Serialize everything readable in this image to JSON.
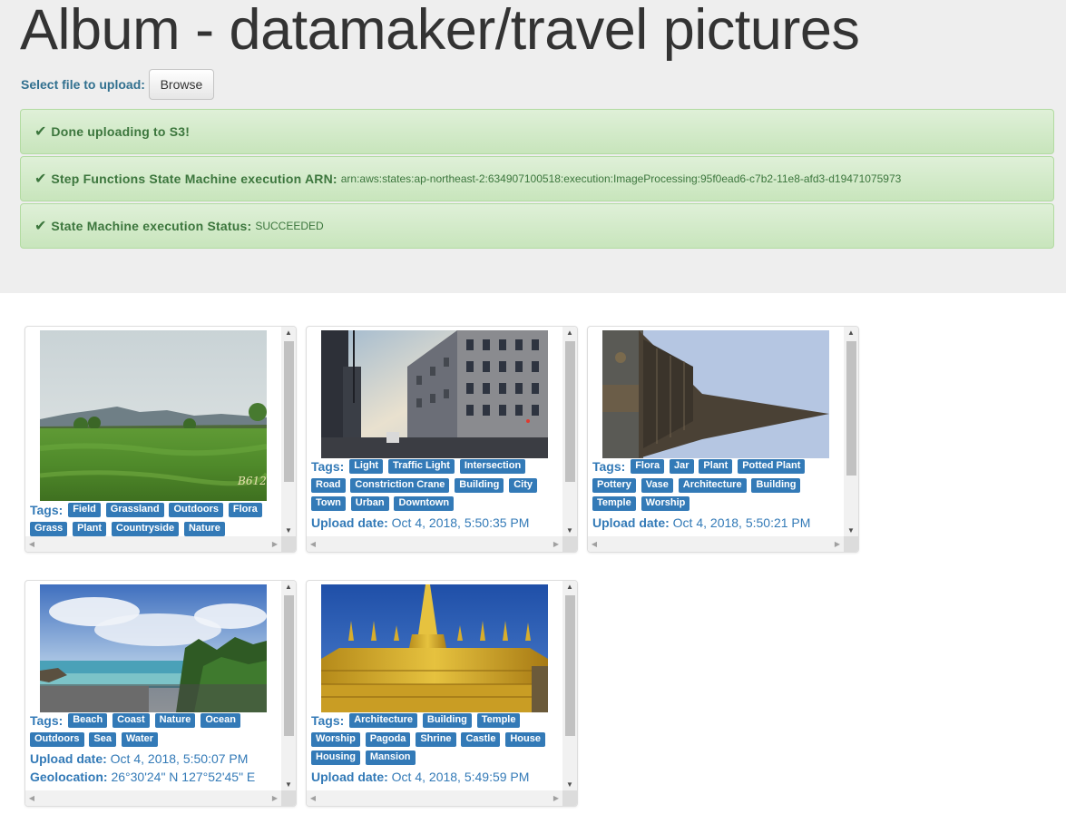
{
  "page": {
    "title": "Album - datamaker/travel pictures",
    "upload_label": "Select file to upload:",
    "browse_label": "Browse"
  },
  "alerts": [
    {
      "label": "Done uploading to S3!",
      "value": ""
    },
    {
      "label": "Step Functions State Machine execution ARN:",
      "value": "arn:aws:states:ap-northeast-2:634907100518:execution:ImageProcessing:95f0ead6-c7b2-11e8-afd3-d19471075973"
    },
    {
      "label": "State Machine execution Status:",
      "value": "SUCCEEDED"
    }
  ],
  "labels": {
    "tags": "Tags:",
    "upload_date": "Upload date:",
    "geolocation": "Geolocation:"
  },
  "photos": [
    {
      "tags": [
        "Field",
        "Grassland",
        "Outdoors",
        "Flora",
        "Grass",
        "Plant",
        "Countryside",
        "Nature"
      ],
      "upload_date": "",
      "geolocation": "",
      "watermark": "B612"
    },
    {
      "tags": [
        "Light",
        "Traffic Light",
        "Intersection",
        "Road",
        "Constriction Crane",
        "Building",
        "City",
        "Town",
        "Urban",
        "Downtown"
      ],
      "upload_date": "Oct 4, 2018, 5:50:35 PM",
      "geolocation": ""
    },
    {
      "tags": [
        "Flora",
        "Jar",
        "Plant",
        "Potted Plant",
        "Pottery",
        "Vase",
        "Architecture",
        "Building",
        "Temple",
        "Worship"
      ],
      "upload_date": "Oct 4, 2018, 5:50:21 PM",
      "geolocation": ""
    },
    {
      "tags": [
        "Beach",
        "Coast",
        "Nature",
        "Ocean",
        "Outdoors",
        "Sea",
        "Water"
      ],
      "upload_date": "Oct 4, 2018, 5:50:07 PM",
      "geolocation": "26°30'24\" N 127°52'45\" E"
    },
    {
      "tags": [
        "Architecture",
        "Building",
        "Temple",
        "Worship",
        "Pagoda",
        "Shrine",
        "Castle",
        "House",
        "Housing",
        "Mansion"
      ],
      "upload_date": "Oct 4, 2018, 5:49:59 PM",
      "geolocation": ""
    }
  ],
  "colors": {
    "jumbotron_bg": "#eeeeee",
    "alert_success_bg": "#dff0d8",
    "alert_success_text": "#3c763d",
    "link_blue": "#337ab7",
    "tag_bg": "#337ab7"
  }
}
